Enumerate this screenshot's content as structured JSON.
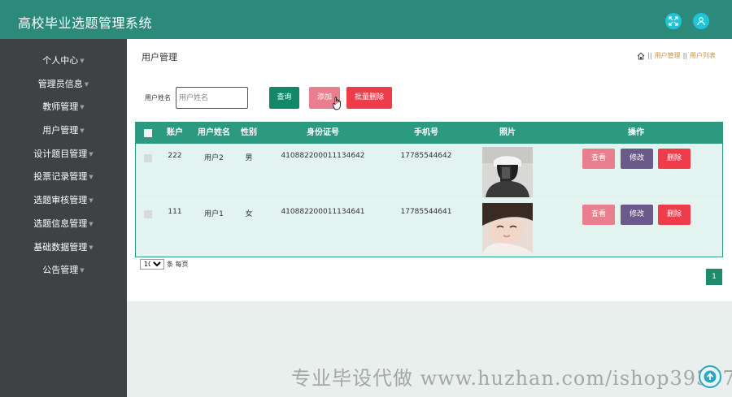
{
  "app": {
    "title": "高校毕业选题管理系统"
  },
  "header": {
    "fullscreen_icon": "expand-icon",
    "user_icon": "user-icon"
  },
  "sidebar": {
    "items": [
      {
        "label": "个人中心"
      },
      {
        "label": "管理员信息"
      },
      {
        "label": "教师管理"
      },
      {
        "label": "用户管理"
      },
      {
        "label": "设计题目管理"
      },
      {
        "label": "投票记录管理"
      },
      {
        "label": "选题审核管理"
      },
      {
        "label": "选题信息管理"
      },
      {
        "label": "基础数据管理"
      },
      {
        "label": "公告管理"
      }
    ],
    "caret": "▼"
  },
  "main": {
    "title": "用户管理",
    "breadcrumb": {
      "home_icon": "home-icon",
      "sep": "||",
      "items": [
        "用户管理",
        "用户列表"
      ]
    }
  },
  "search": {
    "label": "用户姓名",
    "placeholder": "用户姓名",
    "value": ""
  },
  "buttons": {
    "query": "查询",
    "add": "添加",
    "batch_delete": "批量删除"
  },
  "table": {
    "headers": [
      "账户",
      "用户姓名",
      "性别",
      "身份证号",
      "手机号",
      "照片",
      "操作"
    ],
    "rows": [
      {
        "account": "222",
        "name": "用户2",
        "gender": "男",
        "id_card": "410882200011134642",
        "phone": "17785544642"
      },
      {
        "account": "111",
        "name": "用户1",
        "gender": "女",
        "id_card": "410882200011134641",
        "phone": "17785544641"
      }
    ],
    "row_actions": {
      "view": "查看",
      "edit": "修改",
      "delete": "删除"
    }
  },
  "pagination": {
    "page_size": "10",
    "page_size_options": [
      "10"
    ],
    "per_page_label": "条 每页",
    "current_page": "1"
  },
  "watermark": "专业毕设代做 www.huzhan.com/ishop39397",
  "colors": {
    "header": "#2c8a7b",
    "sidebar": "#3e4244",
    "accent": "#2c9a80",
    "danger": "#ef3c4b",
    "pink": "#e97f8e",
    "purple": "#6a5a8a"
  }
}
